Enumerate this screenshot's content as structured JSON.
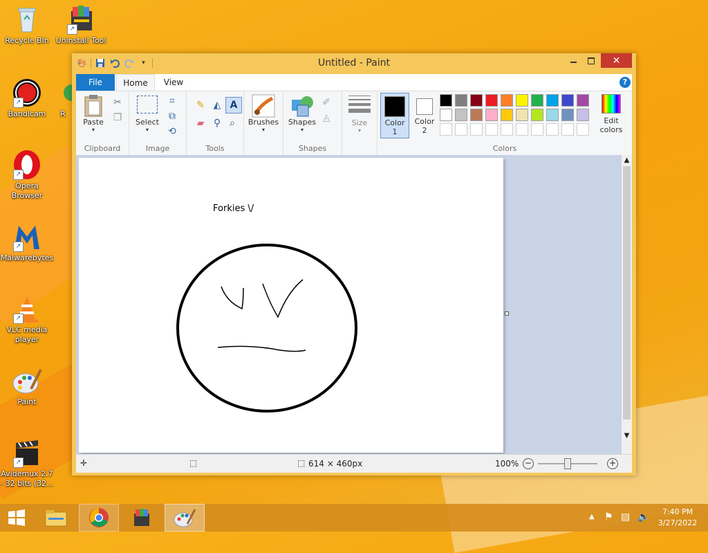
{
  "desktop": {
    "icons": [
      {
        "label": "Recycle Bin",
        "icon": "recycle-bin-icon"
      },
      {
        "label": "Uninstall Tool",
        "icon": "uninstall-tool-icon"
      },
      {
        "label": "Bandicam",
        "icon": "bandicam-icon"
      },
      {
        "label": "R",
        "icon": "partial-app-icon"
      },
      {
        "label": "Opera Browser",
        "icon": "opera-icon"
      },
      {
        "label": "Malwarebytes",
        "icon": "malwarebytes-icon"
      },
      {
        "label": "VLC media player",
        "icon": "vlc-icon"
      },
      {
        "label": "Paint",
        "icon": "paint-icon"
      },
      {
        "label": "Avidemux 2.7 - 32 bits (32...",
        "icon": "avidemux-icon"
      }
    ]
  },
  "window": {
    "title": "Untitled - Paint",
    "tabs": [
      "File",
      "Home",
      "View"
    ],
    "ribbon": {
      "clipboard": {
        "label": "Clipboard",
        "paste": "Paste"
      },
      "image": {
        "label": "Image",
        "select": "Select"
      },
      "tools": {
        "label": "Tools"
      },
      "brushes": "Brushes",
      "shapes": {
        "label": "Shapes",
        "shapes_btn": "Shapes"
      },
      "size": "Size",
      "color1": "Color 1",
      "color2": "Color 2",
      "colors_label": "Colors",
      "edit_colors": "Edit colors",
      "palette_row1": [
        "#000000",
        "#7f7f7f",
        "#880015",
        "#ed1c24",
        "#ff7f27",
        "#fff200",
        "#22b14c",
        "#00a2e8",
        "#3f48cc",
        "#a349a4"
      ],
      "palette_row2": [
        "#ffffff",
        "#c3c3c3",
        "#b97a57",
        "#ffaec9",
        "#ffc90e",
        "#efe4b0",
        "#b5e61d",
        "#99d9ea",
        "#7092be",
        "#c8bfe7"
      ],
      "accent": "#1979ca"
    },
    "canvas": {
      "text": "Forkies \\/"
    },
    "status": {
      "dimensions": "614 × 460px",
      "zoom": "100%"
    }
  },
  "taskbar": {
    "time": "7:40 PM",
    "date": "3/27/2022"
  }
}
